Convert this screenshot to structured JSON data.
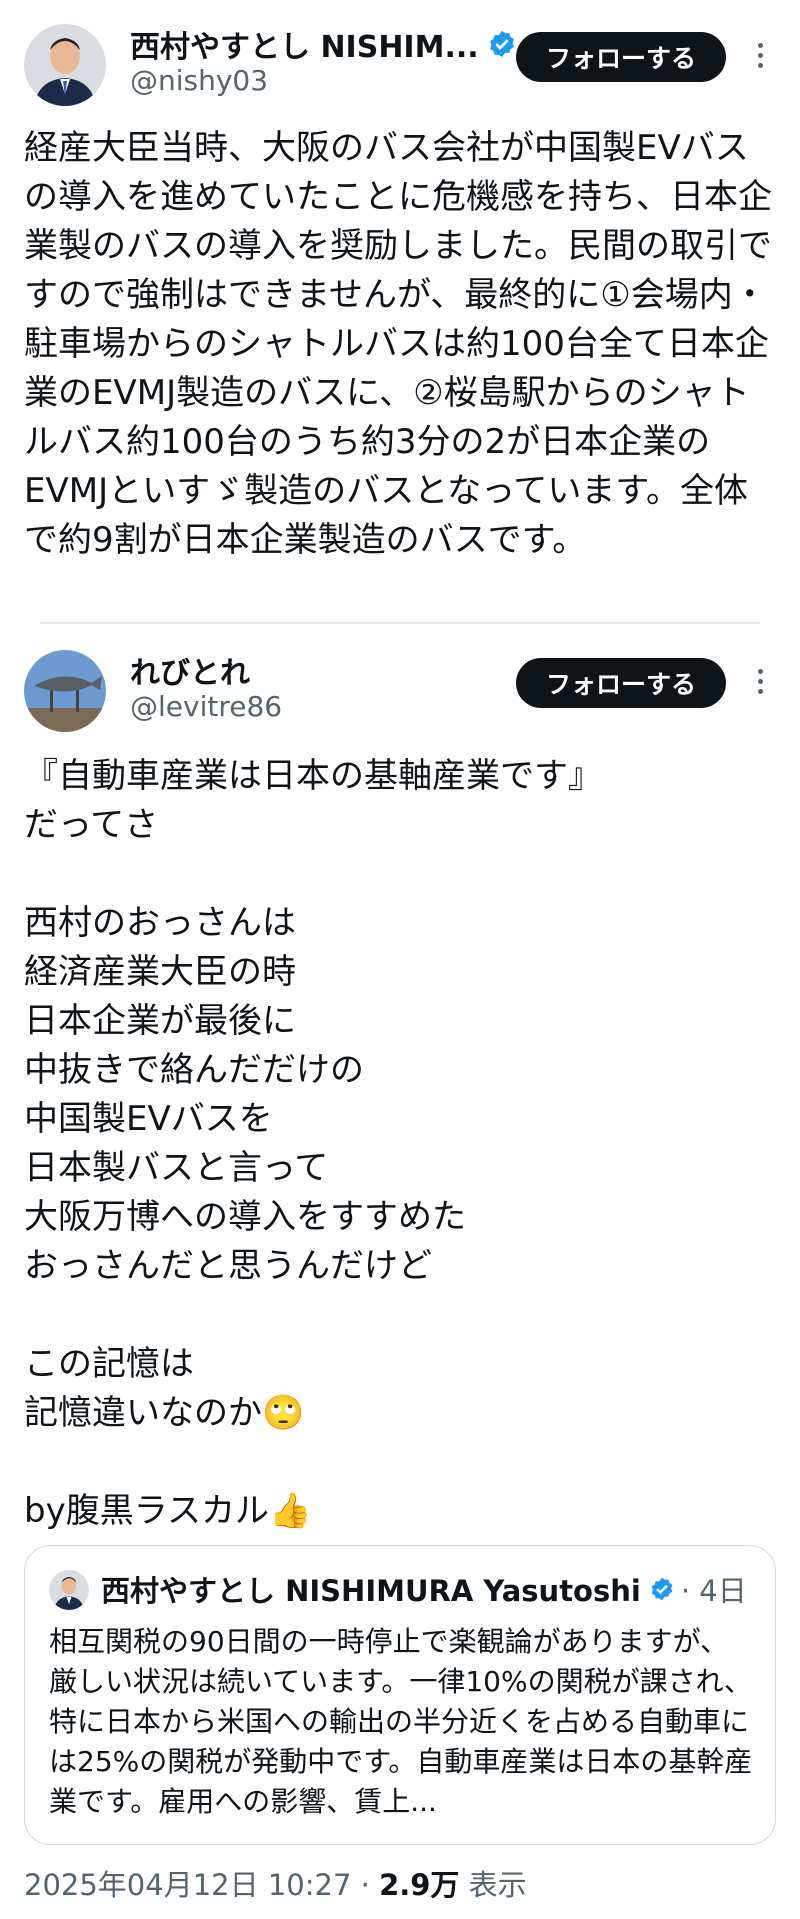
{
  "post1": {
    "display_name": "西村やすとし NISHIM...",
    "handle": "@nishy03",
    "follow_label": "フォローする",
    "text": "経産大臣当時、大阪のバス会社が中国製EVバスの導入を進めていたことに危機感を持ち、日本企業製のバスの導入を奨励しました。民間の取引ですので強制はできませんが、最終的に①会場内・駐車場からのシャトルバスは約100台全て日本企業のEVMJ製造のバスに、②桜島駅からのシャトルバス約100台のうち約3分の2が日本企業のEVMJといすゞ製造のバスとなっています。全体で約9割が日本企業製造のバスです。"
  },
  "post2": {
    "display_name": "れびとれ",
    "handle": "@levitre86",
    "follow_label": "フォローする",
    "text": "『自動車産業は日本の基軸産業です』\nだってさ\n\n西村のおっさんは\n経済産業大臣の時\n日本企業が最後に\n中抜きで絡んだだけの\n中国製EVバスを\n日本製バスと言って\n大阪万博への導入をすすめた\nおっさんだと思うんだけど\n\nこの記憶は\n記憶違いなのか🙄\n\nby腹黒ラスカル👍"
  },
  "quote": {
    "display_name": "西村やすとし NISHIMURA Yasutoshi",
    "time": "· 4日",
    "text": "相互関税の90日間の一時停止で楽観論がありますが、厳しい状況は続いています。一律10%の関税が課され、特に日本から米国への輸出の半分近くを占める自動車には25%の関税が発動中です。自動車産業は日本の基幹産業です。雇用への影響、賃上..."
  },
  "meta": {
    "timestamp": "2025年04月12日 10:27",
    "separator": "·",
    "views": "2.9万",
    "views_label": "表示"
  },
  "colors": {
    "verified": "#1d9bf0",
    "button_bg": "#0f1419",
    "secondary_text": "#536471"
  },
  "icons": [
    "verified-badge-icon",
    "more-options-icon"
  ]
}
